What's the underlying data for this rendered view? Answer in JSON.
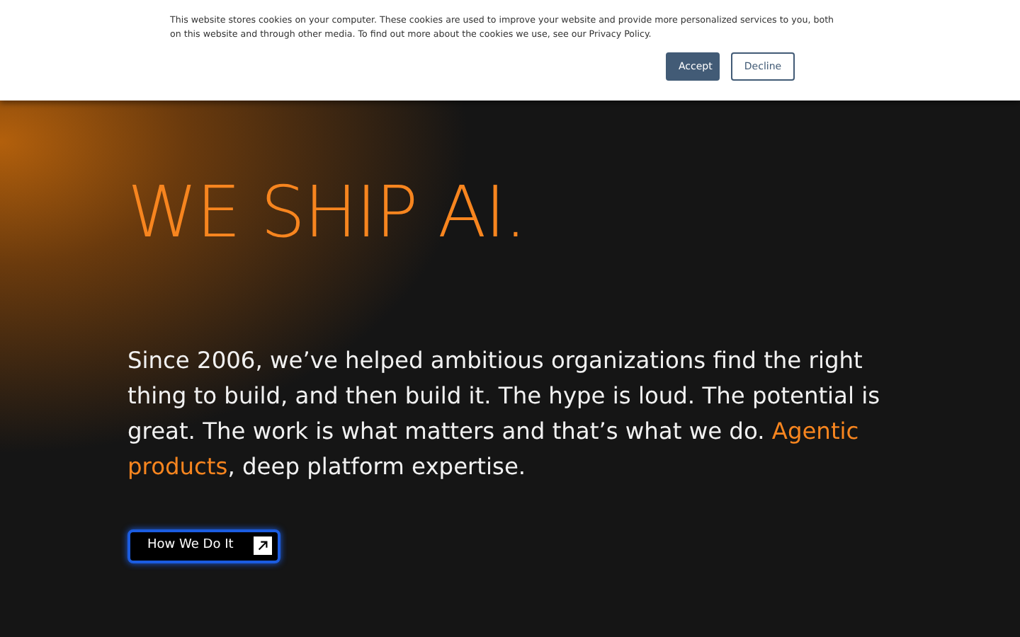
{
  "cookie_banner": {
    "text": "This website stores cookies on your computer. These cookies are used to improve your website and provide more personalized services to you, both on this website and through other media. To find out more about the cookies we use, see our Privacy Policy.",
    "buttons": [
      {
        "label": "Accept",
        "kind": "primary"
      },
      {
        "label": "Decline",
        "kind": "outline"
      }
    ]
  },
  "hero": {
    "title": "WE SHIP AI.",
    "intro": [
      "Since 2006, we’ve helped ambitious organizations find the right thing to build, and then build it. The hype is loud. The potential is great. The work is what matters and that’s what we do. ",
      "Agentic products",
      ", deep platform expertise."
    ],
    "cta": {
      "label": "How We Do It"
    }
  }
}
